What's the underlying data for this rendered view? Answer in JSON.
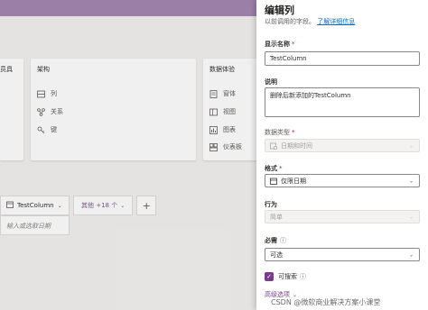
{
  "background": {
    "left_card_partial": {
      "title": "员具",
      "title_suffix": "⌄"
    },
    "schema_card": {
      "title": "架构",
      "items": [
        {
          "icon": "list-icon",
          "label": "列"
        },
        {
          "icon": "relationship-icon",
          "label": "关系"
        },
        {
          "icon": "key-icon",
          "label": "键"
        }
      ]
    },
    "data_experience_card": {
      "title": "数据体验",
      "items": [
        {
          "icon": "form-icon",
          "label": "窗体"
        },
        {
          "icon": "view-icon",
          "label": "视图"
        },
        {
          "icon": "chart-icon",
          "label": "图表"
        },
        {
          "icon": "dashboard-icon",
          "label": "仪表板"
        }
      ]
    },
    "column_header": "TestColumn",
    "more_columns": "其他 +18 个",
    "add_column": "+",
    "cell_placeholder": "输入或选取日期"
  },
  "panel": {
    "title": "编辑列",
    "subtitle": "以前调用的字段。",
    "learn_more": "了解详细信息",
    "display_name": {
      "label": "显示名称",
      "required": "*",
      "value": "TestColumn"
    },
    "description": {
      "label": "说明",
      "value": "删除后新添加的TestColumn"
    },
    "data_type": {
      "label": "数据类型",
      "required": "*",
      "value": "日期和时间",
      "icon": "calendar-clock-icon"
    },
    "format": {
      "label": "格式",
      "required": "*",
      "value": "仅限日期",
      "icon": "calendar-icon"
    },
    "behavior": {
      "label": "行为",
      "value": "简单"
    },
    "required_field": {
      "label": "必需",
      "value": "可选"
    },
    "searchable": {
      "label": "可搜索",
      "checked": true
    },
    "advanced": "高级选项"
  },
  "watermark": "CSDN @微软商业解决方案小课堂",
  "colors": {
    "accent": "#7a3b8f",
    "header": "#9b7fa6",
    "link": "#0f6cbd"
  }
}
